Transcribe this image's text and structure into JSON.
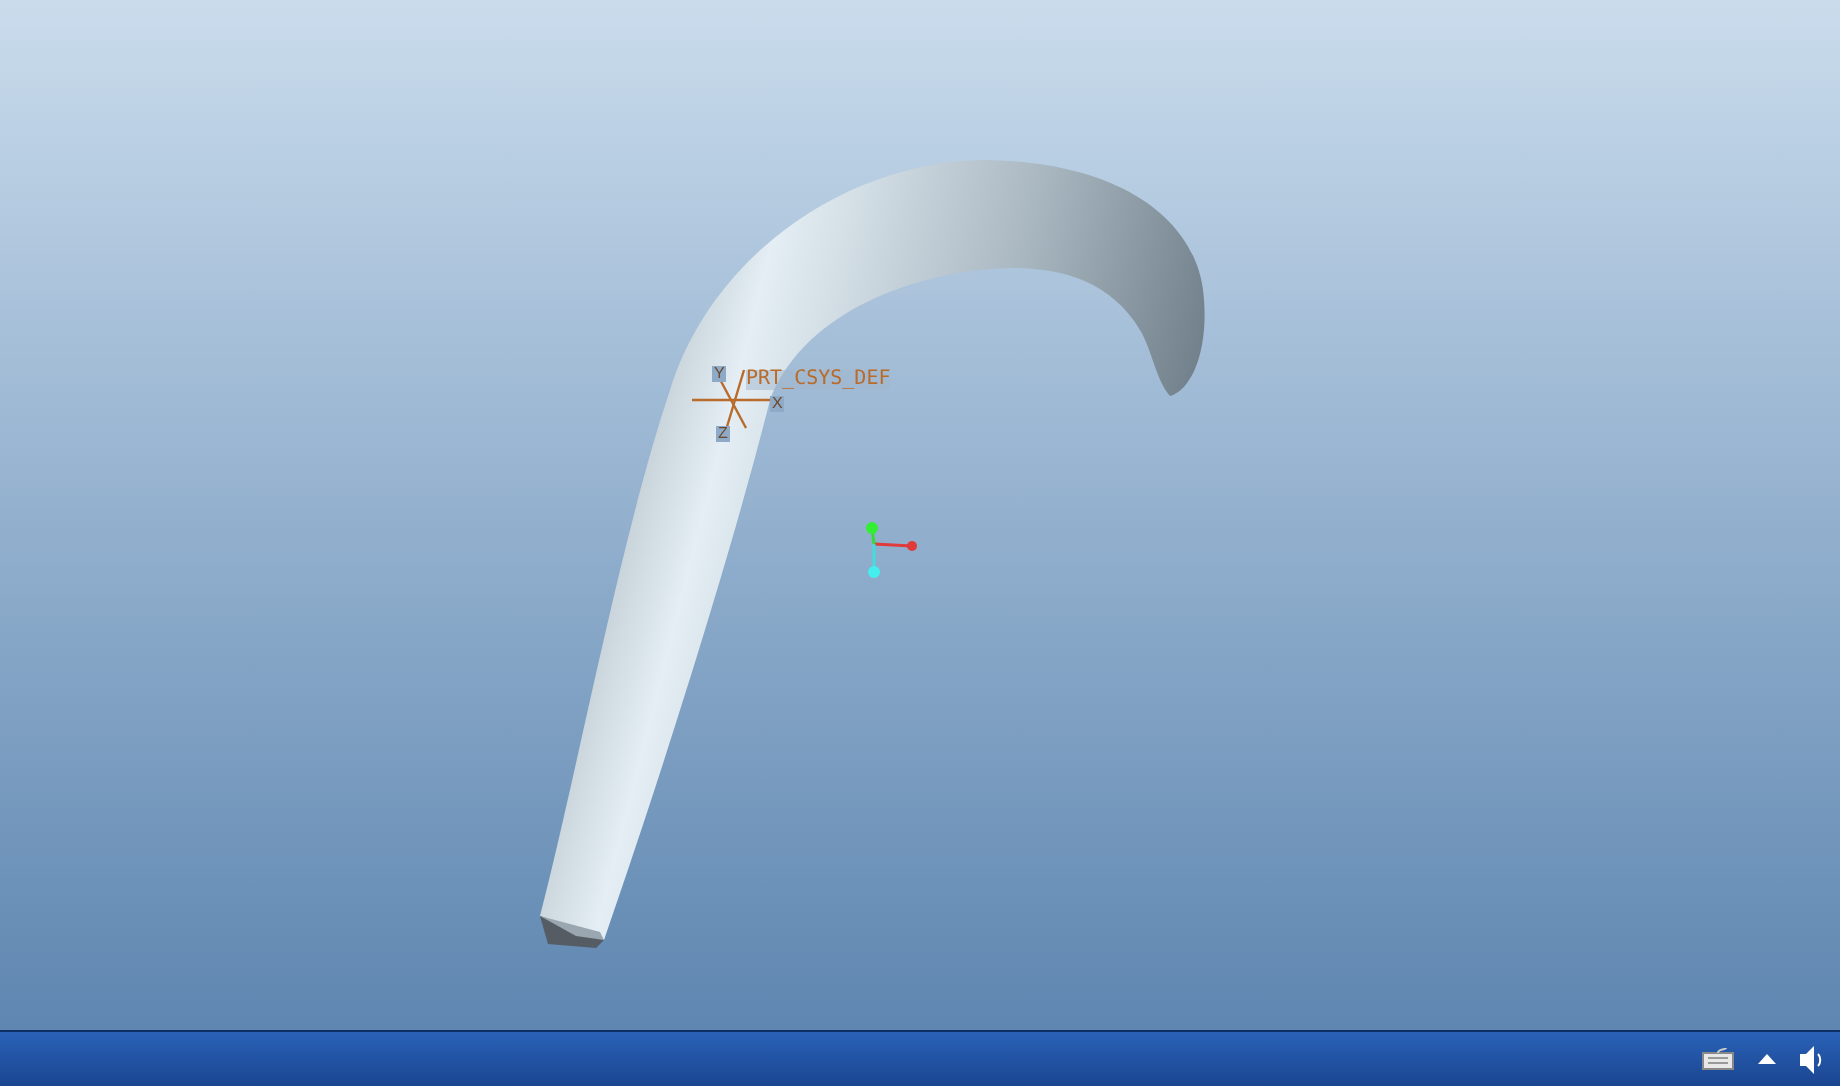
{
  "viewport": {
    "csys": {
      "label": "PRT_CSYS_DEF",
      "axes": [
        {
          "kind": "y",
          "label": "Y"
        },
        {
          "kind": "x",
          "label": "X"
        },
        {
          "kind": "z",
          "label": "Z"
        }
      ]
    }
  }
}
